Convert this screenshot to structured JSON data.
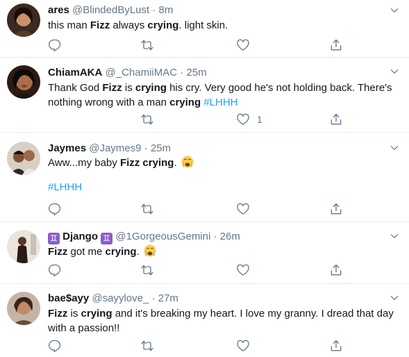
{
  "tweets": [
    {
      "name": "ares",
      "handle": "@BlindedByLust",
      "dot": "·",
      "time": "8m",
      "text": [
        {
          "t": "this man ",
          "b": false
        },
        {
          "t": "Fizz",
          "b": true
        },
        {
          "t": " always ",
          "b": false
        },
        {
          "t": "crying",
          "b": true
        },
        {
          "t": ". light skin.",
          "b": false
        }
      ],
      "like_count": ""
    },
    {
      "name": "ChiamAKA",
      "handle": "@_ChamiiMAC",
      "dot": "·",
      "time": "25m",
      "text_line1": "Thank God Fizz is crying his cry. Very good he's not holding back. There's",
      "text_line2_a": "nothing wrong with a man ",
      "text_line2_b": "crying",
      "hashtag": "#LHHH",
      "like_count": "1"
    },
    {
      "name": "Jaymes",
      "handle": "@Jaymes9",
      "dot": "·",
      "time": "25m",
      "text_a": "Aww...my baby ",
      "text_b": "Fizz crying",
      "text_c": ".",
      "hashtag": "#LHHH",
      "emoji": "loudly-crying-face"
    },
    {
      "name": "Django",
      "zodiac": "♊",
      "handle": "@1GorgeousGemini",
      "dot": "·",
      "time": "26m",
      "text_a": "Fizz",
      "text_b": " got me ",
      "text_c": "crying",
      "text_d": ".",
      "emoji": "loudly-crying-face"
    },
    {
      "name": "bae$ayy",
      "handle": "@sayylove_",
      "dot": "·",
      "time": "27m",
      "text_line1_a": "Fizz",
      "text_line1_b": " is ",
      "text_line1_c": "crying",
      "text_line1_d": " and it's breaking my heart. I love my granny. I dread that day",
      "text_line2": "with a passion!!"
    }
  ],
  "icons": [
    "reply-icon",
    "retweet-icon",
    "like-icon",
    "share-icon",
    "chevron-down-icon"
  ],
  "colors": {
    "accent": "#1da1f2",
    "secondary_text": "#657786",
    "divider": "#e6ecf0"
  }
}
